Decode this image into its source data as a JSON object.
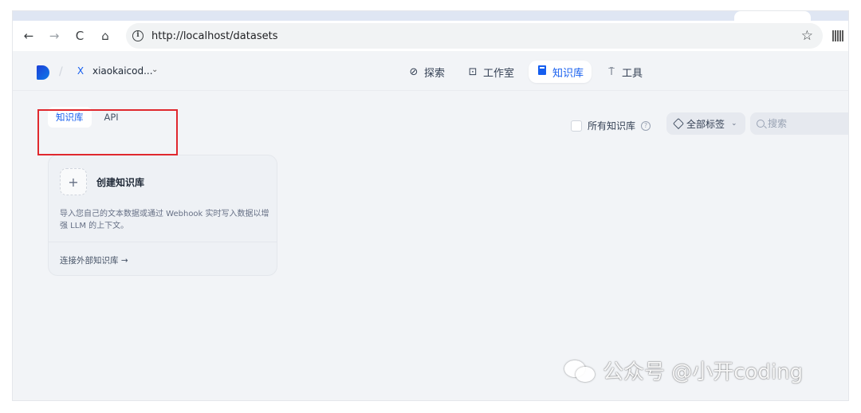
{
  "browser": {
    "url": "http://localhost/datasets",
    "back_icon": "←",
    "forward_icon": "→",
    "reload_icon": "C",
    "home_icon": "⌂",
    "star_icon": "☆"
  },
  "header": {
    "workspace_initial": "X",
    "workspace_name": "xiaokaicod...",
    "workspace_caret": "⌄",
    "nav": [
      {
        "label": "探索",
        "icon": "explore-icon"
      },
      {
        "label": "工作室",
        "icon": "robot-icon"
      },
      {
        "label": "知识库",
        "icon": "book-icon",
        "active": true
      },
      {
        "label": "工具",
        "icon": "tool-icon"
      }
    ]
  },
  "subtabs": [
    {
      "label": "知识库",
      "active": true
    },
    {
      "label": "API",
      "active": false
    }
  ],
  "filters": {
    "all_kb_label": "所有知识库",
    "help_glyph": "?",
    "tag_label": "全部标签",
    "tag_caret": "⌄",
    "search_placeholder": "搜索"
  },
  "create_card": {
    "plus": "+",
    "title": "创建知识库",
    "description": "导入您自己的文本数据或通过 Webhook 实时写入数据以增强 LLM 的上下文。",
    "link": "连接外部知识库 →"
  },
  "watermark": {
    "text": "公众号 @小开coding"
  },
  "colors": {
    "accent": "#155eef",
    "highlight_box": "#e0282e",
    "page_bg": "#f2f4f7"
  }
}
